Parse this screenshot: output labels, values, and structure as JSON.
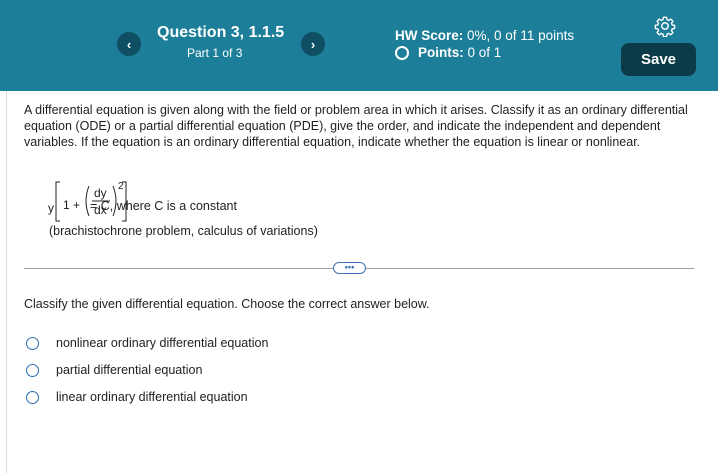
{
  "header": {
    "question_title": "Question 3, 1.1.5",
    "part": "Part 1 of 3",
    "prev_label": "‹",
    "next_label": "›",
    "hw_score_label": "HW Score:",
    "hw_score_value": "0%, 0 of 11 points",
    "points_label": "Points:",
    "points_value": "0 of 1",
    "save_label": "Save",
    "settings_icon": "gear-icon",
    "bg_color": "#1d7e99",
    "save_color": "#0b3b49"
  },
  "problem": {
    "prompt": "A differential equation is given along with the field or problem area in which it arises. Classify it as an ordinary differential equation (ODE) or a partial differential equation (PDE), give the order, and indicate the independent and dependent variables. If the equation is an ordinary differential equation, indicate whether the equation is linear or nonlinear.",
    "equation": {
      "y": "y",
      "one_plus": "1 +",
      "numerator": "dy",
      "denominator": "dx",
      "exponent": "2",
      "suffix": "= C, where C is a constant"
    },
    "context": "(brachistochrone problem, calculus of variations)",
    "more_label": "•••"
  },
  "answer": {
    "instruction": "Classify the given differential equation. Choose the correct answer below.",
    "options": [
      "nonlinear ordinary differential equation",
      "partial differential equation",
      "linear ordinary differential equation"
    ]
  }
}
